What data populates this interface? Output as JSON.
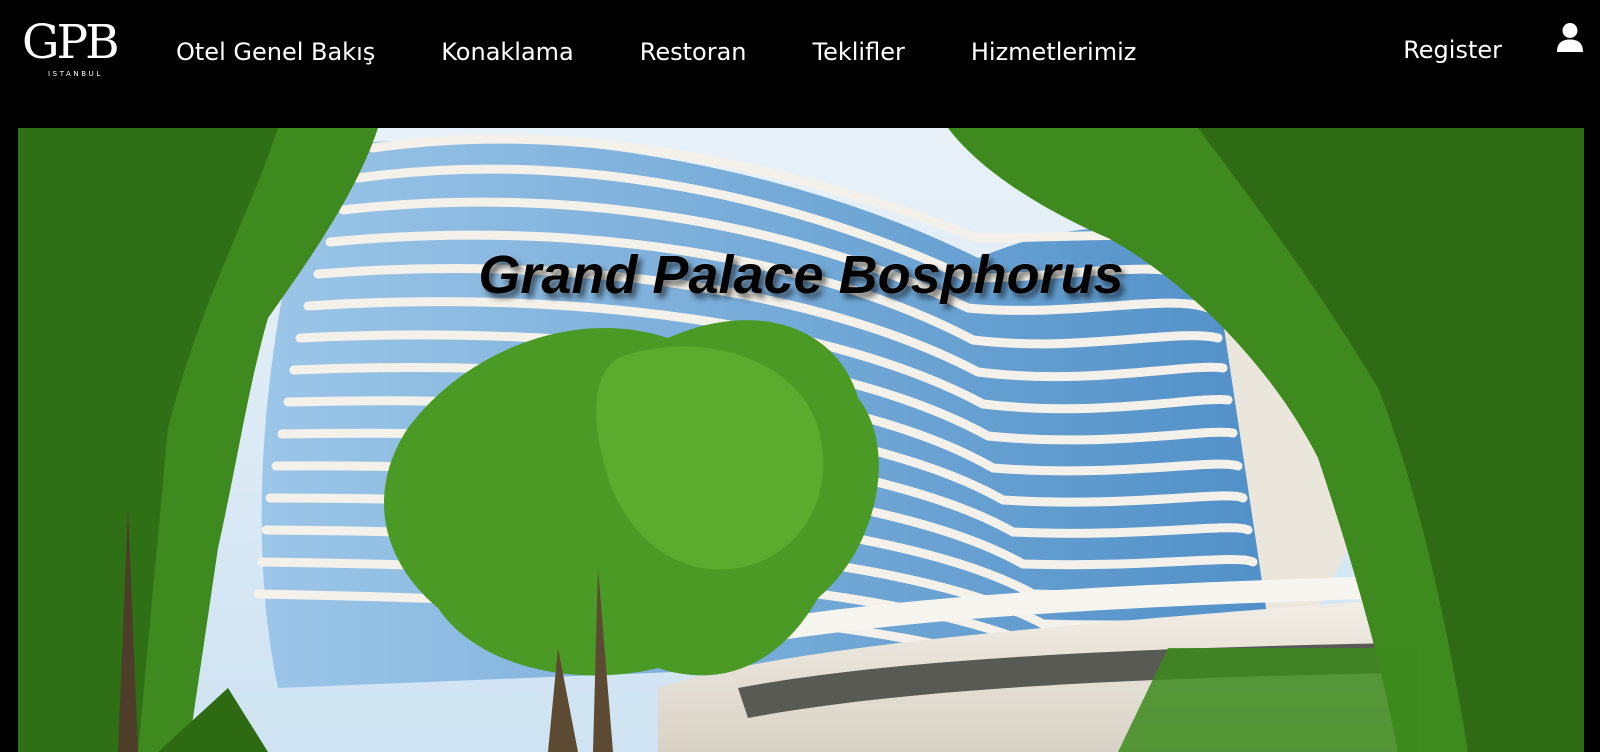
{
  "logo": {
    "mark": "GPB",
    "sub": "ISTANBUL"
  },
  "nav": {
    "items": [
      {
        "label": "Otel Genel Bakış"
      },
      {
        "label": "Konaklama"
      },
      {
        "label": "Restoran"
      },
      {
        "label": "Teklifler"
      },
      {
        "label": "Hizmetlerimiz"
      }
    ],
    "register_label": "Register",
    "user_icon": "user-icon"
  },
  "hero": {
    "title": "Grand Palace Bosphorus",
    "image": "hotel-building-photo"
  },
  "colors": {
    "navbar_bg": "#000000",
    "nav_text": "#ffffff",
    "sky": "#cfe6f5",
    "foliage": "#3f8a1e"
  }
}
